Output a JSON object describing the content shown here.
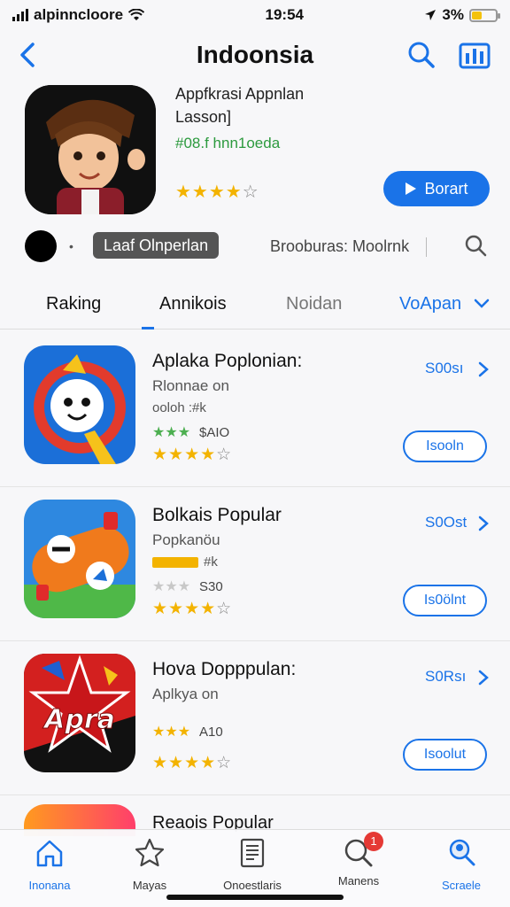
{
  "status_bar": {
    "carrier": "alpinncloore",
    "time": "19:54",
    "battery": "3%"
  },
  "nav": {
    "title": "Indoonsia",
    "back_icon": "chevron-left-icon",
    "search_icon": "search-icon",
    "chart_icon": "chart-icon"
  },
  "hero": {
    "line1": "Appfkrasi Appnlan",
    "line2": "Lasson]",
    "line3": "#08.f hnn1oeda",
    "rating_stars": "★★★★",
    "rating_empty": "☆",
    "get_label": "Borart"
  },
  "sub_bar": {
    "dot_label": "•",
    "pill_label": "Laaf Olnperlan",
    "text": "Brooburas: Moolrnk"
  },
  "tabs": [
    {
      "label": "Raking"
    },
    {
      "label": "Annikois"
    },
    {
      "label": "Noidan"
    },
    {
      "label": "VoApan"
    }
  ],
  "apps": [
    {
      "title": "Aplaka Poplonian:",
      "subtitle": "Rlonnae on",
      "meta": "ooloh :#k",
      "small_stars": "★★★",
      "small_value": "$AIO",
      "stars": "★★★★",
      "stars_empty": "☆",
      "price": "S00sı",
      "button": "Isooln"
    },
    {
      "title": "Bolkais Popular",
      "subtitle": "Popkanöu",
      "meta": "#k",
      "small_stars": "★★★",
      "small_value": "S30",
      "stars": "★★★★",
      "stars_empty": "☆",
      "price": "S0Ost",
      "button": "Is0ölnt"
    },
    {
      "title": "Hova Dopppulan:",
      "subtitle": "Aplkya on",
      "meta": "",
      "small_stars": "★★★",
      "small_value": "A10",
      "stars": "★★★★",
      "stars_empty": "☆",
      "price": "S0Rsı",
      "button": "Isoolut"
    }
  ],
  "peek": {
    "title": "Reaois Popular"
  },
  "tab_bar": [
    {
      "label": "Inonana",
      "icon": "home-icon"
    },
    {
      "label": "Mayas",
      "icon": "star-icon"
    },
    {
      "label": "Onoestlaris",
      "icon": "document-icon"
    },
    {
      "label": "Manens",
      "icon": "search-icon",
      "badge": "1"
    },
    {
      "label": "Scraele",
      "icon": "profile-search-icon"
    }
  ],
  "colors": {
    "accent": "#1a73e8",
    "star": "#f3b300",
    "green": "#2c9a3e",
    "badge": "#e53935"
  }
}
